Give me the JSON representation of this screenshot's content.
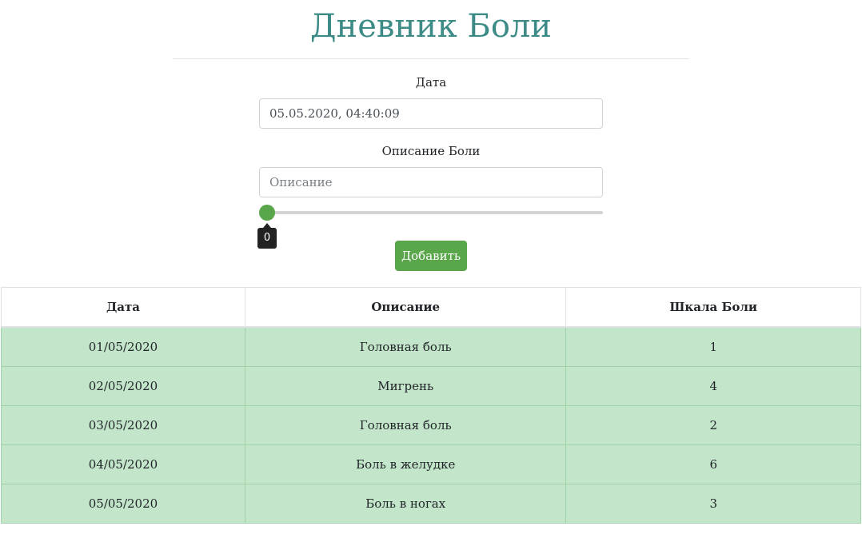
{
  "header": {
    "title": "Дневник Боли"
  },
  "form": {
    "date_label": "Дата",
    "date_value": "05.05.2020, 04:40:09",
    "description_label": "Описание Боли",
    "description_placeholder": "Описание",
    "description_value": "",
    "slider": {
      "value": 0,
      "min": 0,
      "max": 10,
      "value_text": "0"
    },
    "add_button_label": "Добавить",
    "accent_color": "#5aa64b"
  },
  "table": {
    "headers": [
      "Дата",
      "Описание",
      "Шкала Боли"
    ],
    "rows": [
      {
        "date": "01/05/2020",
        "description": "Головная боль",
        "scale": "1"
      },
      {
        "date": "02/05/2020",
        "description": "Мигрень",
        "scale": "4"
      },
      {
        "date": "03/05/2020",
        "description": "Головная боль",
        "scale": "2"
      },
      {
        "date": "04/05/2020",
        "description": "Боль в желудке",
        "scale": "6"
      },
      {
        "date": "05/05/2020",
        "description": "Боль в ногах",
        "scale": "3"
      }
    ],
    "row_color": "#c3e6cb"
  }
}
